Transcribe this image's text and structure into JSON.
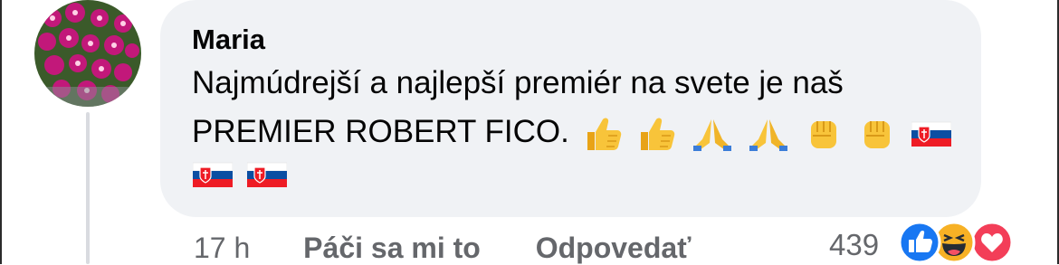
{
  "comment": {
    "author": "Maria",
    "text_line1": "Najmúdrejší a najlepší premiér na svete je naš",
    "text_line2": "PREMIER ROBERT FICO.",
    "emojis": [
      "thumbs-up",
      "thumbs-up",
      "folded-hands",
      "folded-hands",
      "raised-fist",
      "raised-fist",
      "slovakia-flag",
      "slovakia-flag",
      "slovakia-flag"
    ]
  },
  "actions": {
    "time": "17 h",
    "like": "Páči sa mi to",
    "reply": "Odpovedať"
  },
  "reactions": {
    "count": "439",
    "types": [
      "like",
      "haha",
      "love"
    ],
    "colors": {
      "like": "#1877f2",
      "haha": "#f7b125",
      "love": "#f33e58"
    }
  },
  "colors": {
    "bubble": "#f0f2f5",
    "text": "#050505",
    "secondary": "#65676b"
  }
}
